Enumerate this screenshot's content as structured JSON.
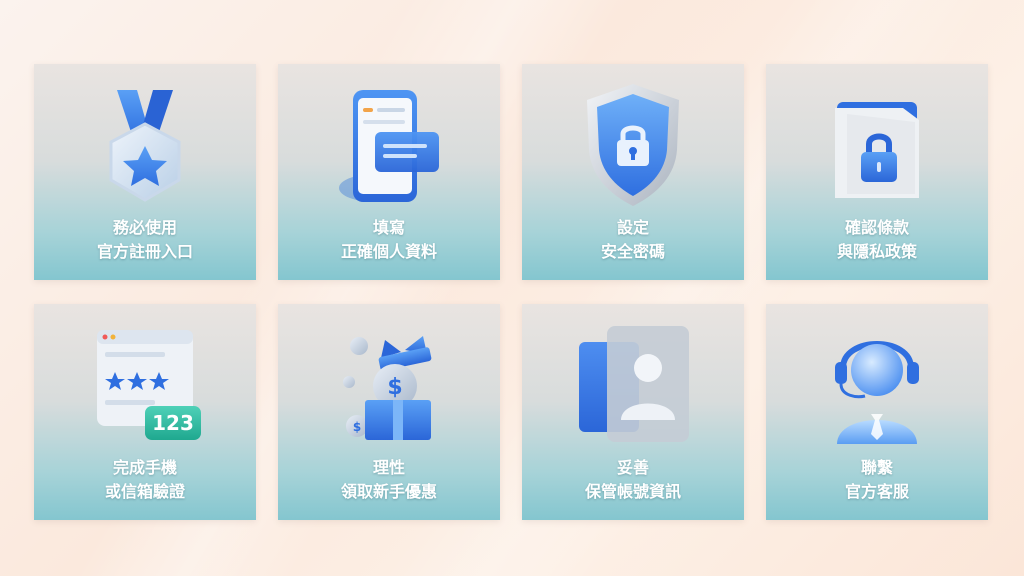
{
  "cards": [
    {
      "line1": "務必使用",
      "line2": "官方註冊入口",
      "icon": "medal-icon"
    },
    {
      "line1": "填寫",
      "line2": "正確個人資料",
      "icon": "phone-form-icon"
    },
    {
      "line1": "設定",
      "line2": "安全密碼",
      "icon": "shield-lock-icon"
    },
    {
      "line1": "確認條款",
      "line2": "與隱私政策",
      "icon": "folder-lock-icon"
    },
    {
      "line1": "完成手機",
      "line2": "或信箱驗證",
      "icon": "password-123-icon"
    },
    {
      "line1": "理性",
      "line2": "領取新手優惠",
      "icon": "gift-coin-icon"
    },
    {
      "line1": "妥善",
      "line2": "保管帳號資訊",
      "icon": "user-card-icon"
    },
    {
      "line1": "聯繫",
      "line2": "官方客服",
      "icon": "support-agent-icon"
    }
  ],
  "colors": {
    "accent": "#3b7be8",
    "card_bottom": "#84c6cf",
    "text": "#ffffff"
  }
}
